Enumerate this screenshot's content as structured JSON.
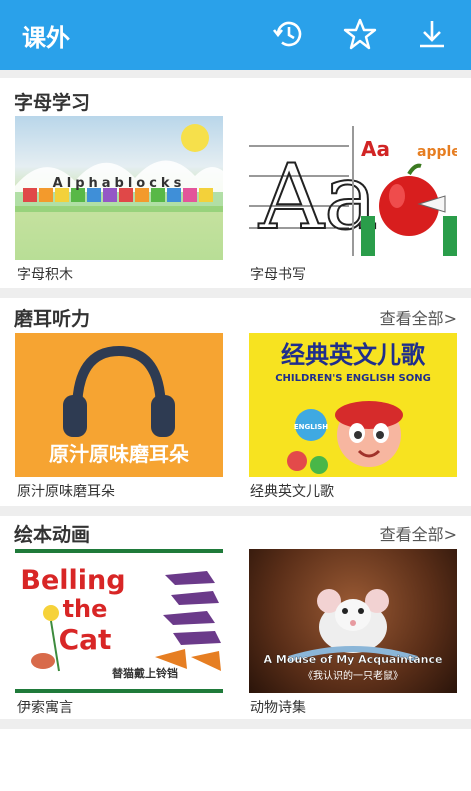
{
  "header": {
    "title": "课外",
    "icons": [
      "history-icon",
      "star-icon",
      "download-icon"
    ]
  },
  "sections": [
    {
      "title": "字母学习",
      "see_all": "",
      "items": [
        {
          "caption": "字母积木",
          "art_text": "Alphablocks"
        },
        {
          "caption": "字母书写",
          "art_text_1": "Aa",
          "art_text_2": "Aa",
          "art_text_3": "apple"
        }
      ]
    },
    {
      "title": "磨耳听力",
      "see_all": "查看全部>",
      "items": [
        {
          "caption": "原汁原味磨耳朵",
          "art_text": "原汁原味磨耳朵"
        },
        {
          "caption": "经典英文儿歌",
          "art_text_1": "经典英文儿歌",
          "art_text_2": "CHILDREN'S ENGLISH SONG",
          "art_text_3": "ENGLISH"
        }
      ]
    },
    {
      "title": "绘本动画",
      "see_all": "查看全部>",
      "items": [
        {
          "caption": "伊索寓言",
          "art_text_1": "Belling",
          "art_text_2": "the",
          "art_text_3": "Cat",
          "art_text_4": "替猫戴上铃铛"
        },
        {
          "caption": "动物诗集",
          "art_text_1": "A Mouse of My Acquaintance",
          "art_text_2": "《我认识的一只老鼠》"
        }
      ]
    }
  ],
  "colors": {
    "header": "#2aa1ea",
    "divider": "#eeeeee",
    "orange": "#f6a432",
    "yellow": "#f7e320"
  }
}
